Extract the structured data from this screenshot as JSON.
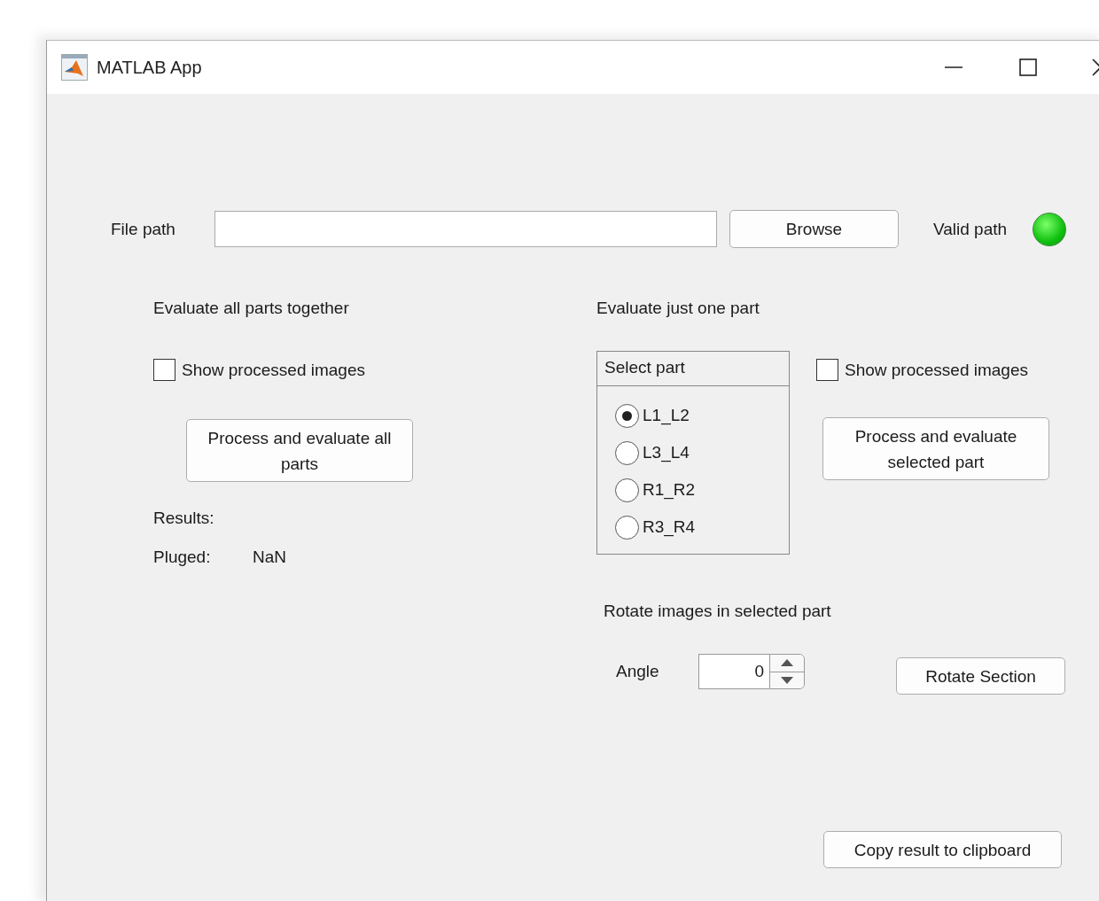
{
  "window": {
    "title": "MATLAB App"
  },
  "file_path": {
    "label": "File path",
    "browse_button": "Browse",
    "valid_label": "Valid path",
    "valid": true
  },
  "all_parts": {
    "heading": "Evaluate all parts together",
    "show_images": {
      "label": "Show processed images",
      "checked": false
    },
    "button": "Process and evaluate all parts",
    "results_label": "Results:",
    "pluged_label": "Pluged:",
    "pluged_value": "NaN"
  },
  "one_part": {
    "heading": "Evaluate just one part",
    "panel_title": "Select part",
    "options": [
      {
        "label": "L1_L2",
        "selected": true
      },
      {
        "label": "L3_L4",
        "selected": false
      },
      {
        "label": "R1_R2",
        "selected": false
      },
      {
        "label": "R3_R4",
        "selected": false
      }
    ],
    "show_images": {
      "label": "Show processed images",
      "checked": false
    },
    "button": "Process and evaluate selected part",
    "rotate_heading": "Rotate images in selected part",
    "angle_label": "Angle",
    "angle_value": "0",
    "rotate_button": "Rotate Section"
  },
  "copy_button": "Copy result to clipboard"
}
